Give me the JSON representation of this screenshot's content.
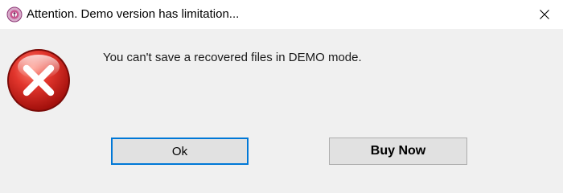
{
  "window": {
    "title": "Attention. Demo version has limitation...",
    "app_icon": "app-disc-icon",
    "close_icon": "close-icon"
  },
  "dialog": {
    "icon": "error-icon",
    "message": "You can't save a recovered files in DEMO mode."
  },
  "buttons": {
    "ok_label": "Ok",
    "buy_label": "Buy Now"
  },
  "colors": {
    "titlebar_bg": "#ffffff",
    "dialog_bg": "#f0f0f0",
    "button_bg": "#e1e1e1",
    "focus_border": "#0078d7",
    "error_red": "#d9302a"
  }
}
